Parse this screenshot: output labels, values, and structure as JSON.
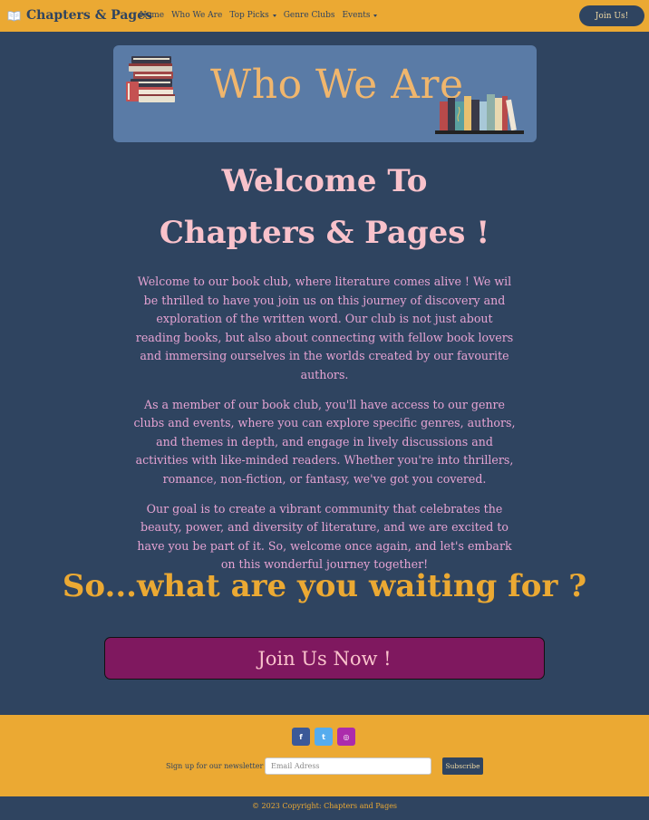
{
  "navbar": {
    "brand": "Chapters & Pages",
    "brand_icon": "open-book-icon",
    "links": [
      {
        "label": "Home",
        "dropdown": false
      },
      {
        "label": "Who We Are",
        "dropdown": false
      },
      {
        "label": "Top Picks",
        "dropdown": true
      },
      {
        "label": "Genre Clubs",
        "dropdown": false
      },
      {
        "label": "Events",
        "dropdown": true
      }
    ],
    "join_button": "Join Us!"
  },
  "banner": {
    "title": "Who We Are",
    "left_image": "book-stack-illustration",
    "right_image": "bookshelf-illustration"
  },
  "welcome": {
    "line1": "Welcome To",
    "line2": "Chapters & Pages !",
    "paragraphs": [
      "Welcome to our book club, where literature comes alive ! We wil be thrilled to have you join us on this journey of discovery and exploration of the written word. Our club is not just about reading books, but also about connecting with fellow book lovers and immersing ourselves in the worlds created by our favourite authors.",
      "As a member of our book club, you'll have access to our genre clubs and events, where you can explore specific genres, authors, and themes in depth, and engage in lively discussions and activities with like-minded readers. Whether you're into thrillers, romance, non-fiction, or fantasy, we've got you covered.",
      "Our goal is to create a vibrant community that celebrates the beauty, power, and diversity of literature, and we are excited to have you be part of it. So, welcome once again, and let's embark on this wonderful journey together!"
    ]
  },
  "cta": {
    "heading": "So...what are you waiting for ?",
    "button": "Join Us Now !"
  },
  "footer": {
    "socials": [
      {
        "icon": "facebook-icon",
        "glyph": "f"
      },
      {
        "icon": "twitter-icon",
        "glyph": "t"
      },
      {
        "icon": "instagram-icon",
        "glyph": "◎"
      }
    ],
    "newsletter_label": "Sign up for our newsletter :",
    "email_placeholder": "Email Adress",
    "subscribe_label": "Subscribe",
    "copyright": "© 2023 Copyright: Chapters and Pages"
  },
  "colors": {
    "navy": "#2f4460",
    "mustard": "#eba933",
    "pink": "#f9c2cb",
    "mauve": "#e6a3d3",
    "plum": "#7f185f",
    "banner_blue": "#5a7ba6"
  }
}
